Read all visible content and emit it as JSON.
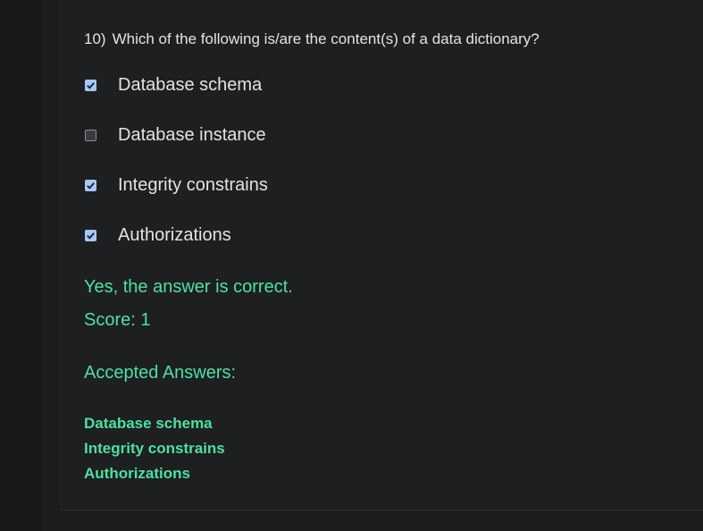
{
  "question": {
    "number": "10)",
    "text": "Which of the following is/are the content(s) of a data dictionary?"
  },
  "options": [
    {
      "label": "Database schema",
      "checked": true
    },
    {
      "label": "Database instance",
      "checked": false
    },
    {
      "label": "Integrity constrains",
      "checked": true
    },
    {
      "label": "Authorizations",
      "checked": true
    }
  ],
  "feedback": {
    "result": "Yes, the answer is correct.",
    "score": "Score: 1",
    "accepted_title": "Accepted Answers:",
    "accepted_answers": [
      "Database schema",
      "Integrity constrains",
      "Authorizations"
    ]
  },
  "colors": {
    "checked": "#a8c7fa",
    "feedback": "#4ee0a0",
    "background": "#1e1f21"
  }
}
